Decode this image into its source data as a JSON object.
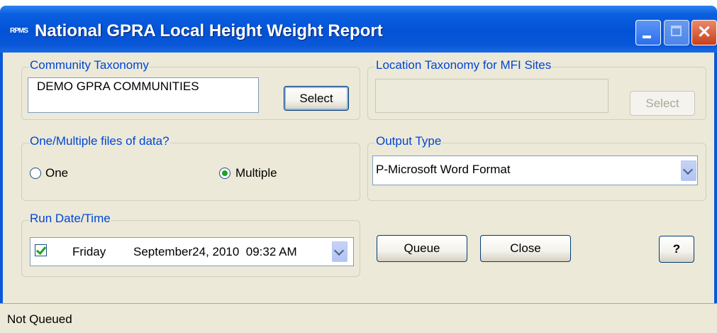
{
  "window": {
    "title": "National GPRA Local Height Weight Report",
    "app_icon": "RPMS",
    "close_glyph": "✕"
  },
  "community": {
    "legend": "Community Taxonomy",
    "value": "DEMO GPRA COMMUNITIES",
    "select_label": "Select"
  },
  "location": {
    "legend": "Location Taxonomy for MFI Sites",
    "value": "",
    "select_label": "Select"
  },
  "files": {
    "legend": "One/Multiple files of data?",
    "options": [
      {
        "label": "One",
        "selected": false
      },
      {
        "label": "Multiple",
        "selected": true
      }
    ]
  },
  "output": {
    "legend": "Output Type",
    "value": "P-Microsoft Word Format"
  },
  "run": {
    "legend": "Run Date/Time",
    "checked": true,
    "day": "Friday",
    "datetime": "September24, 2010  09:32 AM"
  },
  "buttons": {
    "queue": "Queue",
    "close": "Close",
    "help": "?"
  },
  "status": {
    "text": "Not Queued"
  },
  "colors": {
    "titlebar": "#0352d6",
    "legend_text": "#0046d5",
    "dialog_bg": "#ece9d8",
    "radio_dot": "#21a121"
  }
}
